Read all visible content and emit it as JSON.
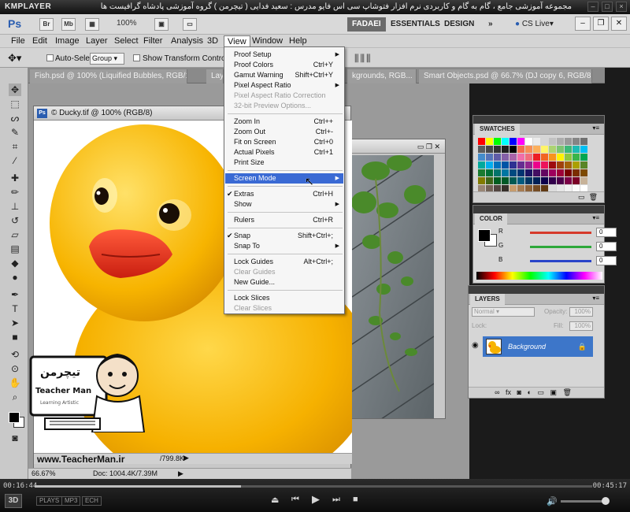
{
  "player": {
    "logo": "KMPLAYER",
    "title": "مجموعه آموزشی جامع ، گام به گام و کاربردی نرم افزار فتوشاپ سی اس فایو   مدرس : سعید فدایی ( تیچرمن ) گروه آموزشی پادشاه گرافیست ها",
    "time_elapsed": "00:16:44",
    "time_total": "00:45:17",
    "progress": 0.37,
    "volume": 0.85,
    "badges": [
      "PLAYS",
      "MP3",
      "ECH"
    ],
    "btn_3d": "3D"
  },
  "appbar": {
    "logo": "Ps",
    "br": "Br",
    "mb": "Mb",
    "zoom": "100%",
    "workspaces": [
      "FADAEI",
      "ESSENTIALS",
      "DESIGN"
    ],
    "more": "»",
    "cslive": "CS Live"
  },
  "menubar": [
    "File",
    "Edit",
    "Image",
    "Layer",
    "Select",
    "Filter",
    "Analysis",
    "3D",
    "View",
    "Window",
    "Help"
  ],
  "options": {
    "autoselect": "Auto-Select:",
    "group_value": "Group",
    "show_transform": "Show Transform Controls"
  },
  "tabs": [
    "Fish.psd @ 100% (Liquified Bubbles, RGB/1...",
    "Lay",
    "kgrounds, RGB...",
    "Smart Objects.psd @ 66.7% (DJ copy 6, RGB/8)"
  ],
  "doc_main": {
    "title": "© Ducky.tif @ 100% (RGB/8)",
    "zoom": "66.67%",
    "doc_info": "Doc: 1004.4K/7.39M",
    "partial_info": "/799.8K"
  },
  "view_menu": [
    {
      "label": "Proof Setup",
      "sub": true
    },
    {
      "label": "Proof Colors",
      "sc": "Ctrl+Y"
    },
    {
      "label": "Gamut Warning",
      "sc": "Shift+Ctrl+Y"
    },
    {
      "label": "Pixel Aspect Ratio",
      "sub": true
    },
    {
      "label": "Pixel Aspect Ratio Correction",
      "dis": true
    },
    {
      "label": "32-bit Preview Options...",
      "dis": true
    },
    {
      "sep": true
    },
    {
      "label": "Zoom In",
      "sc": "Ctrl++"
    },
    {
      "label": "Zoom Out",
      "sc": "Ctrl+-"
    },
    {
      "label": "Fit on Screen",
      "sc": "Ctrl+0"
    },
    {
      "label": "Actual Pixels",
      "sc": "Ctrl+1"
    },
    {
      "label": "Print Size"
    },
    {
      "sep": true
    },
    {
      "label": "Screen Mode",
      "sub": true,
      "hl": true
    },
    {
      "sep": true
    },
    {
      "label": "Extras",
      "sc": "Ctrl+H",
      "check": true
    },
    {
      "label": "Show",
      "sub": true
    },
    {
      "sep": true
    },
    {
      "label": "Rulers",
      "sc": "Ctrl+R"
    },
    {
      "sep": true
    },
    {
      "label": "Snap",
      "sc": "Shift+Ctrl+;",
      "check": true
    },
    {
      "label": "Snap To",
      "sub": true
    },
    {
      "sep": true
    },
    {
      "label": "Lock Guides",
      "sc": "Alt+Ctrl+;"
    },
    {
      "label": "Clear Guides",
      "dis": true
    },
    {
      "label": "New Guide..."
    },
    {
      "sep": true
    },
    {
      "label": "Lock Slices"
    },
    {
      "label": "Clear Slices",
      "dis": true
    }
  ],
  "panels": {
    "swatches": {
      "title": "SWATCHES"
    },
    "color": {
      "title": "COLOR",
      "channels": [
        {
          "name": "R",
          "value": "0",
          "color": "#d63a2b"
        },
        {
          "name": "G",
          "value": "0",
          "color": "#2da83a"
        },
        {
          "name": "B",
          "value": "0",
          "color": "#2a44c9"
        }
      ]
    },
    "layers": {
      "title": "LAYERS",
      "blend": "Normal",
      "opacity_label": "Opacity:",
      "opacity": "100%",
      "lock_label": "Lock:",
      "fill_label": "Fill:",
      "fill": "100%",
      "layer_name": "Background"
    }
  },
  "watermark": {
    "url": "www.TeacherMan.ir",
    "brand": "Teacher Man",
    "brand_fa": "تیچرمن",
    "tagline": "Learning Artistic"
  },
  "colors": {
    "accent": "#3a6ad4",
    "duck": "#f7b500",
    "beak": "#e63b22"
  }
}
